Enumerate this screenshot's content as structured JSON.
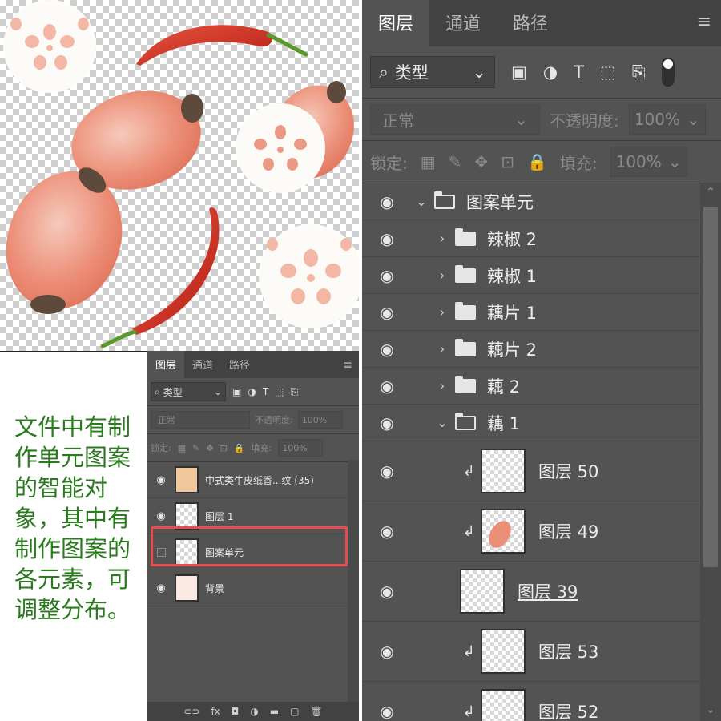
{
  "note": {
    "text": "文件中有制作单元图案的智能对象，其中有制作图案的各元素，可调整分布。"
  },
  "colors": {
    "panel_bg": "#535353",
    "tab_bar_bg": "#424242",
    "note_text": "#2a7a1e",
    "highlight": "#e84b4b",
    "lotus_pink": "#ec8f78",
    "chili_red": "#c8281c"
  },
  "small_panel": {
    "tabs": [
      {
        "label": "图层",
        "active": true
      },
      {
        "label": "通道",
        "active": false
      },
      {
        "label": "路径",
        "active": false
      }
    ],
    "menu_icon": "≡",
    "filter_label": "类型",
    "blend_mode": "正常",
    "opacity_label": "不透明度:",
    "opacity_value": "100%",
    "lock_label": "锁定:",
    "fill_label": "填充:",
    "fill_value": "100%",
    "layers": [
      {
        "name": "中式类牛皮纸香...纹 (35)",
        "visible": true
      },
      {
        "name": "图层 1",
        "visible": true
      },
      {
        "name": "图案单元",
        "visible": false,
        "highlighted": true
      },
      {
        "name": "背景",
        "visible": true
      }
    ],
    "footer_icons": [
      "link-icon",
      "fx-icon",
      "mask-icon",
      "adjustment-icon",
      "folder-icon",
      "new-layer-icon",
      "trash-icon"
    ],
    "footer_glyphs": [
      "⊂⊃",
      "fx",
      "◘",
      "◑",
      "▬",
      "▢",
      "🗑"
    ]
  },
  "big_panel": {
    "tabs": [
      {
        "label": "图层",
        "active": true
      },
      {
        "label": "通道",
        "active": false
      },
      {
        "label": "路径",
        "active": false
      }
    ],
    "menu_icon": "≡",
    "filter_label": "类型",
    "blend_mode": "正常",
    "opacity_label": "不透明度:",
    "opacity_value": "100%",
    "lock_label": "锁定:",
    "fill_label": "填充:",
    "fill_value": "100%",
    "group_root": "图案单元",
    "groups": [
      {
        "name": "辣椒 2",
        "expanded": false
      },
      {
        "name": "辣椒 1",
        "expanded": false
      },
      {
        "name": "藕片 1",
        "expanded": false
      },
      {
        "name": "藕片 2",
        "expanded": false
      },
      {
        "name": "藕 2",
        "expanded": false
      },
      {
        "name": "藕 1",
        "expanded": true
      }
    ],
    "layers": [
      {
        "name": "图层 50",
        "clipped": true
      },
      {
        "name": "图层 49",
        "clipped": true
      },
      {
        "name": "图层 39",
        "clipped": false
      },
      {
        "name": "图层 53",
        "clipped": true
      },
      {
        "name": "图层 52",
        "clipped": true
      }
    ]
  }
}
